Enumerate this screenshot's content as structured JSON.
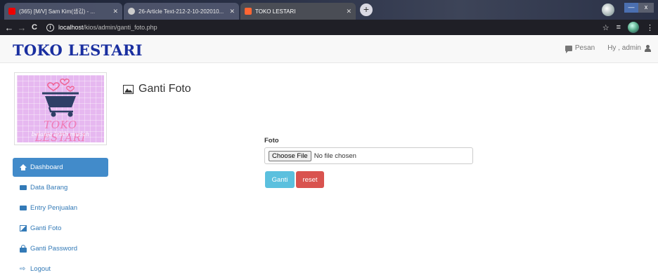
{
  "browser": {
    "tabs": [
      {
        "label": "(365) [M/V] Sam Kim(샘김) - ...",
        "favicon_color": "#ff0000",
        "active": false
      },
      {
        "label": "26-Article Text-212-2-10-202010...",
        "favicon_color": "#dddddd",
        "active": false
      },
      {
        "label": "TOKO LESTARI",
        "favicon_color": "#ff6633",
        "active": true
      }
    ],
    "new_tab": "+",
    "nav": {
      "back": "←",
      "forward": "→",
      "reload": "C"
    },
    "address": {
      "host": "localhost",
      "path": "/kios/admin/ganti_foto.php"
    },
    "window": {
      "minimize": "—",
      "close": "x"
    }
  },
  "app": {
    "brand": "TOKO LESTARI",
    "brand_color": "#1a2fa0",
    "nav_right": {
      "pesan": "Pesan",
      "user": "Hy , admin"
    },
    "logo": {
      "title": "TOKO LESTARI",
      "tagline": "belanja lebih mudah"
    }
  },
  "sidebar": {
    "items": [
      {
        "label": "Dashboard",
        "icon": "home-icon",
        "active": true
      },
      {
        "label": "Data Barang",
        "icon": "bank-icon",
        "active": false
      },
      {
        "label": "Entry Penjualan",
        "icon": "bank-icon",
        "active": false
      },
      {
        "label": "Ganti Foto",
        "icon": "picture-icon",
        "active": false
      },
      {
        "label": "Ganti Password",
        "icon": "lock-icon",
        "active": false
      },
      {
        "label": "Logout",
        "icon": "logout-icon",
        "active": false
      }
    ]
  },
  "main": {
    "title": "Ganti Foto",
    "form": {
      "label": "Foto",
      "file_button": "Choose File",
      "file_status": "No file chosen",
      "submit": "Ganti",
      "reset": "reset"
    }
  },
  "colors": {
    "primary": "#428bca",
    "info": "#5bc0de",
    "danger": "#d9534f",
    "link": "#337ab7"
  }
}
